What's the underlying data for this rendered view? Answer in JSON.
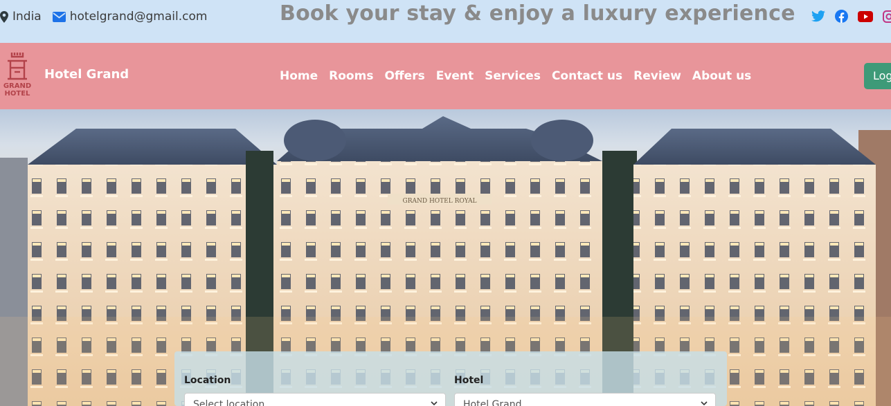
{
  "topbar": {
    "location": "India",
    "email": "hotelgrand@gmail.com",
    "headline": "Book your stay & enjoy a luxury experience",
    "social": [
      "twitter-icon",
      "facebook-icon",
      "youtube-icon",
      "instagram-icon"
    ]
  },
  "navbar": {
    "logo_line1": "GRAND",
    "logo_line2": "HOTEL",
    "brand": "Hotel Grand",
    "menu": [
      "Home",
      "Rooms",
      "Offers",
      "Event",
      "Services",
      "Contact us",
      "Review",
      "About us"
    ],
    "login": "Log"
  },
  "hero": {
    "building_sign": "GRAND HOTEL ROYAL"
  },
  "booking": {
    "location_label": "Location",
    "location_value": "Select location",
    "hotel_label": "Hotel",
    "hotel_value": "Hotel Grand"
  },
  "colors": {
    "topbar_bg": "#cfe3f6",
    "navbar_bg": "#e8959a",
    "login_bg": "#3e9a78",
    "accent_blue": "#1d72e8"
  }
}
